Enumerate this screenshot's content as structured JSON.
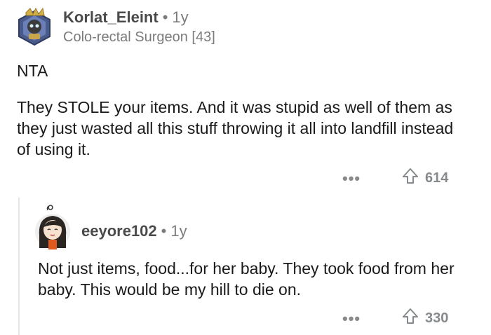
{
  "comment1": {
    "username": "Korlat_Eleint",
    "separator": "•",
    "age": "1y",
    "flair": "Colo-rectal Surgeon [43]",
    "paragraphs": [
      "NTA",
      "They STOLE your items. And it was stupid as well of them as they just wasted all this stuff throwing it all into landfill instead of using it."
    ],
    "more_icon": "more-horizontal-icon",
    "upvote_icon": "upvote-arrow-icon",
    "score": "614"
  },
  "comment2": {
    "username": "eeyore102",
    "separator": "•",
    "age": "1y",
    "paragraphs": [
      "Not just items, food...for her baby. They took food from her baby. This would be my hill to die on."
    ],
    "more_icon": "more-horizontal-icon",
    "upvote_icon": "upvote-arrow-icon",
    "score": "330"
  }
}
